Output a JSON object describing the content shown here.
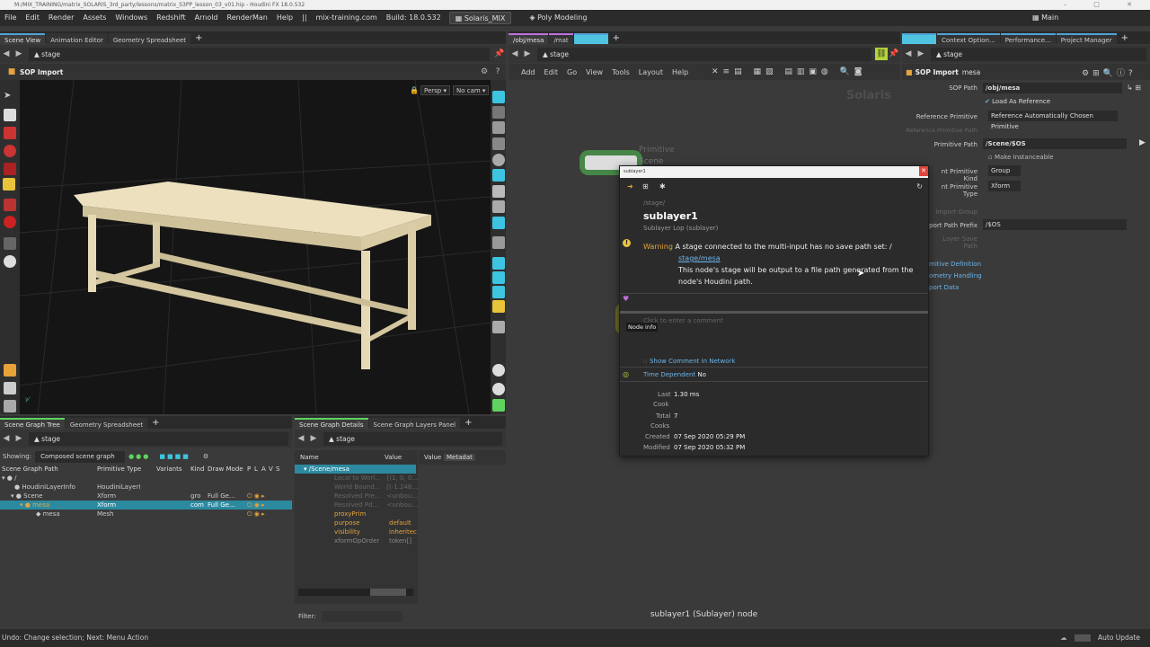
{
  "titlebar": {
    "text": "M:/MIX_TRAINING/matrix_SOLARIS_3rd_party/lessons/matrix_S3PP_lesson_03_v01.hip - Houdini FX 18.0.532"
  },
  "menubar": {
    "items": [
      "File",
      "Edit",
      "Render",
      "Assets",
      "Windows",
      "Redshift",
      "Arnold",
      "RenderMan",
      "Help",
      "||",
      "mix-training.com",
      "Build: 18.0.532"
    ],
    "desktop": "Solaris_MIX",
    "shelfset": "Poly Modeling",
    "main": "Main"
  },
  "left_pane": {
    "tabs": [
      "Scene View",
      "Animation Editor",
      "Geometry Spreadsheet"
    ],
    "path": "stage",
    "node_label": "SOP Import",
    "viewport": {
      "persp": "Persp",
      "cam": "No cam"
    }
  },
  "scene_graph_tree": {
    "tabs": [
      "Scene Graph Tree",
      "Geometry Spreadsheet"
    ],
    "path": "stage",
    "showing_label": "Showing:",
    "showing_value": "Composed scene graph",
    "columns": [
      "Scene Graph Path",
      "Primitive Type",
      "Variants",
      "Kind",
      "Draw Mode",
      "P",
      "L",
      "A",
      "V",
      "S"
    ],
    "rows": [
      {
        "path": "/",
        "type": "",
        "kind": "",
        "draw": ""
      },
      {
        "path": "HoudiniLayerInfo",
        "type": "HoudiniLayerI",
        "kind": "",
        "draw": ""
      },
      {
        "path": "Scene",
        "type": "Xform",
        "kind": "gro",
        "draw": "Full Ge..."
      },
      {
        "path": "mesa",
        "type": "Xform",
        "kind": "com",
        "draw": "Full Ge..."
      },
      {
        "path": "mesa",
        "type": "Mesh",
        "kind": "",
        "draw": ""
      }
    ]
  },
  "scene_graph_details": {
    "tabs": [
      "Scene Graph Details",
      "Scene Graph Layers Panel"
    ],
    "path": "stage",
    "columns": [
      "Name",
      "Value",
      "Value",
      "Metadat"
    ],
    "root": "/Scene/mesa",
    "rows": [
      {
        "name": "Local to Worl...",
        "value": "[(1, 0, 0..."
      },
      {
        "name": "World Bound...",
        "value": "[(-1.248..."
      },
      {
        "name": "Resolved Pre...",
        "value": "<unbou..."
      },
      {
        "name": "Resolved Pd...",
        "value": "<unbou..."
      },
      {
        "name": "proxyPrim",
        "value": ""
      },
      {
        "name": "purpose",
        "value": "default"
      },
      {
        "name": "visibility",
        "value": "inheritec"
      },
      {
        "name": "xformOpOrder",
        "value": "token[]"
      }
    ],
    "filter_label": "Filter:"
  },
  "network": {
    "tabs": [
      "/obj/mesa",
      "/mat"
    ],
    "path": "stage",
    "menu": [
      "Add",
      "Edit",
      "Go",
      "View",
      "Tools",
      "Layout",
      "Help"
    ],
    "context_label": "Solaris",
    "node_name": "Primitive",
    "node_sub": "Scene",
    "footer": "sublayer1 (Sublayer) node"
  },
  "popup": {
    "title": "sublayer1",
    "path": "/stage/",
    "name": "sublayer1",
    "type": "Sublayer Lop (sublayer)",
    "warning_label": "Warning",
    "warning_text": "A stage connected to the multi-input has no save path set: /",
    "warning_link": "stage/mesa",
    "warning_text2": "This node's stage will be output to a file path generated from the node's Houdini path.",
    "comment_placeholder": "Click to enter a comment",
    "node_info_tip": "Node info",
    "show_comment": "Show Comment in Network",
    "time_dep_label": "Time Dependent",
    "time_dep_value": "No",
    "last_label": "Last",
    "last_value": "1.30 ms",
    "cook_label": "Cook",
    "total_label": "Total",
    "total_value": "7",
    "cooks_label": "Cooks",
    "created_label": "Created",
    "created_value": "07 Sep 2020 05:29 PM",
    "modified_label": "Modified",
    "modified_value": "07 Sep 2020 05:32 PM"
  },
  "params": {
    "tabs": [
      "Context Option...",
      "Performance...",
      "Project Manager"
    ],
    "path": "stage",
    "node_type": "SOP Import",
    "node_name": "mesa",
    "sop_path_label": "SOP Path",
    "sop_path": "/obj/mesa",
    "load_as_ref": "Load As Reference",
    "ref_prim_label": "Reference Primitive",
    "ref_prim_value": "Reference Automatically Chosen Primitive",
    "ref_prim_path_label": "Reference Primitive Path",
    "prim_path_label": "Primitive Path",
    "prim_path": "/Scene/$OS",
    "make_instanceable": "Make Instanceable",
    "parent_kind_label": "nt Primitive Kind",
    "parent_kind": "Group",
    "parent_type_label": "nt Primitive Type",
    "parent_type": "Xform",
    "import_group_label": "Import Group",
    "import_prefix_label": "port Path Prefix",
    "import_prefix": "/$OS",
    "layer_save_label": "Layer Save Path",
    "sections": [
      "mitive Definition",
      "ometry Handling",
      "port Data"
    ]
  },
  "statusbar": {
    "left": "Undo: Change selection; Next: Menu Action",
    "right": "Auto Update"
  }
}
